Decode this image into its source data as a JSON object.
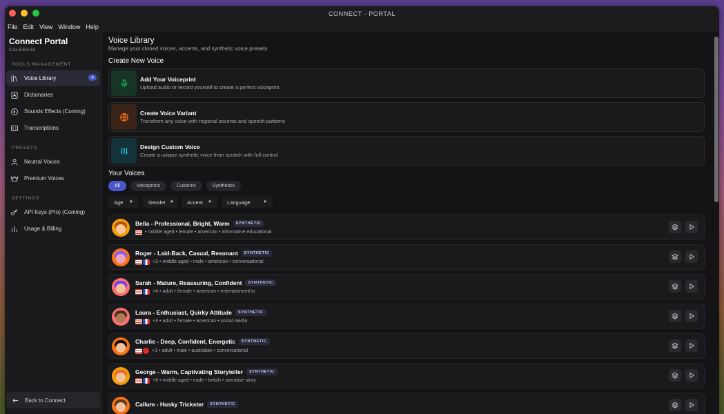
{
  "window": {
    "title": "CONNECT - PORTAL"
  },
  "menu": [
    "File",
    "Edit",
    "View",
    "Window",
    "Help"
  ],
  "sidebar": {
    "brand": "Connect Portal",
    "user": "CALEB509",
    "sections": [
      {
        "title": "TOOLS MANAGEMENT",
        "items": [
          {
            "label": "Voice Library",
            "icon": "library-icon",
            "active": true,
            "badge": "4"
          },
          {
            "label": "Dictionaries",
            "icon": "book-icon"
          },
          {
            "label": "Sounds Effects (Coming)",
            "icon": "sound-icon"
          },
          {
            "label": "Transcriptions",
            "icon": "caption-icon"
          }
        ]
      },
      {
        "title": "PRESETS",
        "items": [
          {
            "label": "Neutral Voices",
            "icon": "user-icon"
          },
          {
            "label": "Premium Voices",
            "icon": "crown-icon"
          }
        ]
      },
      {
        "title": "SETTINGS",
        "items": [
          {
            "label": "API Keys (Pro) (Coming)",
            "icon": "key-icon"
          },
          {
            "label": "Usage & Billing",
            "icon": "bar-chart-icon"
          }
        ]
      }
    ],
    "back": "Back to Connect"
  },
  "main": {
    "title": "Voice Library",
    "subtitle": "Manage your cloned voices, accents, and synthetic voice presets",
    "create_title": "Create New Voice",
    "create_cards": [
      {
        "title": "Add Your Voiceprint",
        "desc": "Upload audio or record yourself to create a perfect voiceprint",
        "icon": "microphone-icon",
        "color": "#22c55e"
      },
      {
        "title": "Create Voice Variant",
        "desc": "Transform any voice with regional accents and speech patterns",
        "icon": "globe-icon",
        "color": "#f97316"
      },
      {
        "title": "Design Custom Voice",
        "desc": "Create a unique synthetic voice from scratch with full control",
        "icon": "sliders-icon",
        "color": "#22d3ee"
      }
    ],
    "your_voices_title": "Your Voices",
    "chips": [
      "All",
      "Voiceprints",
      "Customs",
      "Synthetics"
    ],
    "filters": [
      "Age",
      "Gender",
      "Accent",
      "Language"
    ],
    "voices": [
      {
        "name": "Bella - Professional, Bright, Warm",
        "tag": "SYNTHETIC",
        "flags": [
          "us"
        ],
        "more": "",
        "meta": "• middle aged • female • american • informative educational",
        "avatar_bg": "#f59e0b",
        "face": "#f6c79e",
        "hair": "#b45309"
      },
      {
        "name": "Roger - Laid-Back, Casual, Resonant",
        "tag": "SYNTHETIC",
        "flags": [
          "us",
          "fr"
        ],
        "more": "+3",
        "meta": "• middle aged • male • american • conversational",
        "avatar_bg": "#f97316",
        "face": "#e9a4c0",
        "hair": "#8b5cf6"
      },
      {
        "name": "Sarah - Mature, Reassuring, Confident",
        "tag": "SYNTHETIC",
        "flags": [
          "us",
          "fr"
        ],
        "more": "+4",
        "meta": "• adult • female • american • entertainment tv",
        "avatar_bg": "#f87171",
        "face": "#f3c29a",
        "hair": "#7c3aed"
      },
      {
        "name": "Laura - Enthusiast, Quirky Attitude",
        "tag": "SYNTHETIC",
        "flags": [
          "us",
          "fr"
        ],
        "more": "+3",
        "meta": "• adult • female • american • social media",
        "avatar_bg": "#f87171",
        "face": "#b07a5a",
        "hair": "#4b2e1e"
      },
      {
        "name": "Charlie - Deep, Confident, Energetic",
        "tag": "SYNTHETIC",
        "flags": [
          "us",
          "pt"
        ],
        "more": "+3",
        "meta": "• adult • male • australian • conversational",
        "avatar_bg": "#f97316",
        "face": "#f3c29a",
        "hair": "#111111"
      },
      {
        "name": "George - Warm, Captivating Storyteller",
        "tag": "SYNTHETIC",
        "flags": [
          "us",
          "fr"
        ],
        "more": "+6",
        "meta": "• middle aged • male • british • narrative story",
        "avatar_bg": "#f59e0b",
        "face": "#f3c29a",
        "hair": "#e66b2a"
      },
      {
        "name": "Callum - Husky Trickster",
        "tag": "SYNTHETIC",
        "flags": [],
        "more": "",
        "meta": "",
        "avatar_bg": "#f97316",
        "face": "#f3c29a",
        "hair": "#5b3a1e"
      }
    ]
  }
}
